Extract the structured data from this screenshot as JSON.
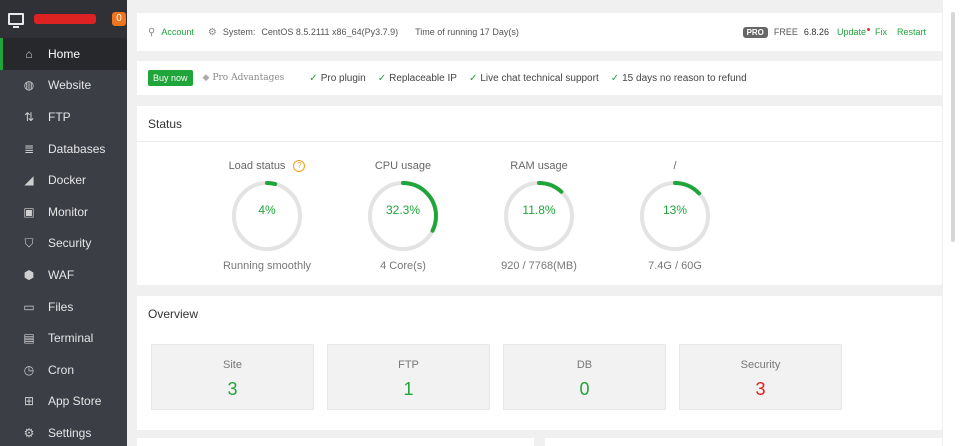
{
  "sidebar": {
    "badge_count": "0",
    "items": [
      {
        "label": "Home",
        "icon": "home-icon",
        "glyph": "⌂",
        "active": true
      },
      {
        "label": "Website",
        "icon": "globe-icon",
        "glyph": "◍"
      },
      {
        "label": "FTP",
        "icon": "transfer-icon",
        "glyph": "⇅"
      },
      {
        "label": "Databases",
        "icon": "database-icon",
        "glyph": "≣"
      },
      {
        "label": "Docker",
        "icon": "docker-icon",
        "glyph": "◢"
      },
      {
        "label": "Monitor",
        "icon": "monitor-icon",
        "glyph": "▣"
      },
      {
        "label": "Security",
        "icon": "shield-icon",
        "glyph": "⛉"
      },
      {
        "label": "WAF",
        "icon": "firewall-icon",
        "glyph": "⬢"
      },
      {
        "label": "Files",
        "icon": "folder-icon",
        "glyph": "▭"
      },
      {
        "label": "Terminal",
        "icon": "terminal-icon",
        "glyph": "▤"
      },
      {
        "label": "Cron",
        "icon": "clock-icon",
        "glyph": "◷"
      },
      {
        "label": "App Store",
        "icon": "apps-icon",
        "glyph": "⊞"
      },
      {
        "label": "Settings",
        "icon": "gear-icon",
        "glyph": "⚙"
      }
    ]
  },
  "topbar": {
    "account": "Account",
    "system_label": "System:",
    "system_value": "CentOS 8.5.2111 x86_64(Py3.7.9)",
    "uptime": "Time of running 17 Day(s)",
    "pro_badge": "PRO",
    "edition": "FREE",
    "version": "6.8.26",
    "update": "Update",
    "fix": "Fix",
    "restart": "Restart"
  },
  "promo": {
    "buy": "Buy now",
    "pro_advantages": "Pro Advantages",
    "features": [
      "Pro plugin",
      "Replaceable IP",
      "Live chat technical support",
      "15 days no reason to refund"
    ]
  },
  "status": {
    "title": "Status",
    "gauges": [
      {
        "label": "Load status",
        "value": "4%",
        "fraction": 0.04,
        "sub": "Running smoothly",
        "help": "?"
      },
      {
        "label": "CPU usage",
        "value": "32.3%",
        "fraction": 0.323,
        "sub": "4 Core(s)"
      },
      {
        "label": "RAM usage",
        "value": "11.8%",
        "fraction": 0.118,
        "sub": "920 / 7768(MB)"
      },
      {
        "label": "/",
        "value": "13%",
        "fraction": 0.13,
        "sub": "7.4G / 60G"
      }
    ]
  },
  "overview": {
    "title": "Overview",
    "boxes": [
      {
        "label": "Site",
        "value": "3"
      },
      {
        "label": "FTP",
        "value": "1"
      },
      {
        "label": "DB",
        "value": "0"
      },
      {
        "label": "Security",
        "value": "3",
        "alert": true
      }
    ]
  },
  "colors": {
    "accent": "#20a53a",
    "danger": "#e02020",
    "sidebar": "#3b3e45",
    "badge": "#f0731d"
  }
}
